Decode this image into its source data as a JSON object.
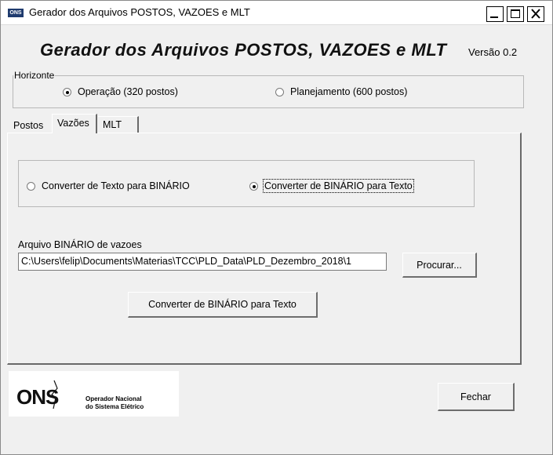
{
  "window": {
    "title": "Gerador dos Arquivos POSTOS, VAZOES e MLT",
    "icon_text": "ONS",
    "controls": [
      "minimize-icon",
      "maximize-icon",
      "close-icon"
    ]
  },
  "header": {
    "title": "Gerador dos Arquivos POSTOS, VAZOES e MLT",
    "version": "Versão 0.2"
  },
  "horizonte": {
    "label": "Horizonte",
    "options": [
      {
        "label": "Operação (320 postos)",
        "selected": true
      },
      {
        "label": "Planejamento (600 postos)",
        "selected": false
      }
    ]
  },
  "tabs": [
    {
      "label": "Postos",
      "active": false
    },
    {
      "label": "Vazões",
      "active": true
    },
    {
      "label": "MLT",
      "active": false
    }
  ],
  "vazoes_panel": {
    "conversion_options": [
      {
        "label": "Converter de Texto para BINÁRIO",
        "selected": false
      },
      {
        "label": "Converter de BINÁRIO para Texto",
        "selected": true
      }
    ],
    "file_label": "Arquivo BINÁRIO de vazoes",
    "file_path": "C:\\Users\\felip\\Documents\\Materias\\TCC\\PLD_Data\\PLD_Dezembro_2018\\1",
    "browse_label": "Procurar...",
    "convert_label": "Converter de BINÁRIO para Texto"
  },
  "footer": {
    "logo_text": "ONS",
    "logo_caption_1": "Operador Nacional",
    "logo_caption_2": "do Sistema Elétrico",
    "close_label": "Fechar"
  }
}
